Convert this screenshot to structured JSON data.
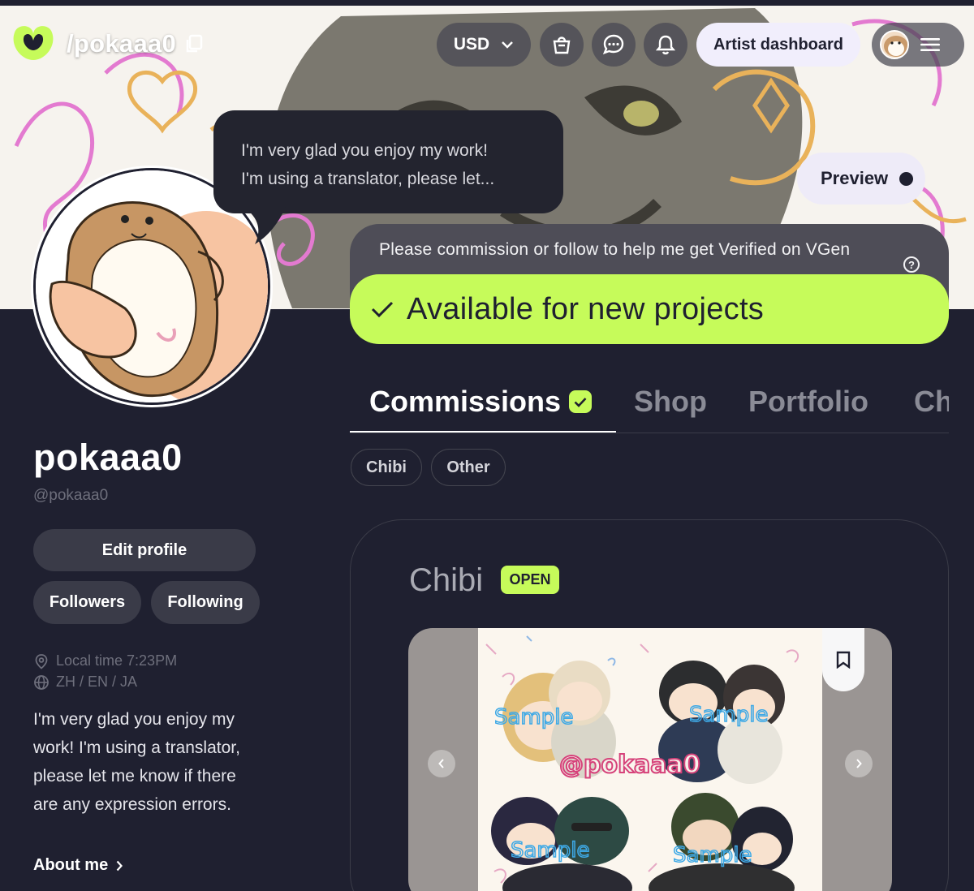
{
  "nav": {
    "handle": "/pokaaa0",
    "currency": "USD",
    "artist_dashboard": "Artist dashboard"
  },
  "bubble": {
    "line1": "I'm very glad you enjoy my work!",
    "line2": "I'm using a translator, please let..."
  },
  "preview": {
    "label": "Preview",
    "enabled": false
  },
  "verify": {
    "text": "Please commission or follow to help me get Verified on VGen",
    "help": "?",
    "availability": "Available for new projects"
  },
  "profile": {
    "display_name": "pokaaa0",
    "username": "@pokaaa0",
    "edit_profile": "Edit profile",
    "followers": "Followers",
    "following": "Following",
    "local_time": "Local time 7:23PM",
    "languages": "ZH / EN / JA",
    "bio": "I'm very glad you enjoy my work! I'm using a translator, please let me know if there are any expression errors.",
    "about_me": "About me"
  },
  "tabs": [
    {
      "label": "Commissions",
      "active": true,
      "verified": true
    },
    {
      "label": "Shop",
      "active": false
    },
    {
      "label": "Portfolio",
      "active": false
    },
    {
      "label": "Ch",
      "active": false
    }
  ],
  "filters": [
    "Chibi",
    "Other"
  ],
  "commission": {
    "title": "Chibi",
    "status": "OPEN",
    "watermark": "@pokaaa0",
    "sample_label": "Sample"
  },
  "colors": {
    "background": "#1f2030",
    "accent_green": "#c6fb5a",
    "pill": "#3a3b48",
    "muted_text": "#6e6f7c"
  }
}
